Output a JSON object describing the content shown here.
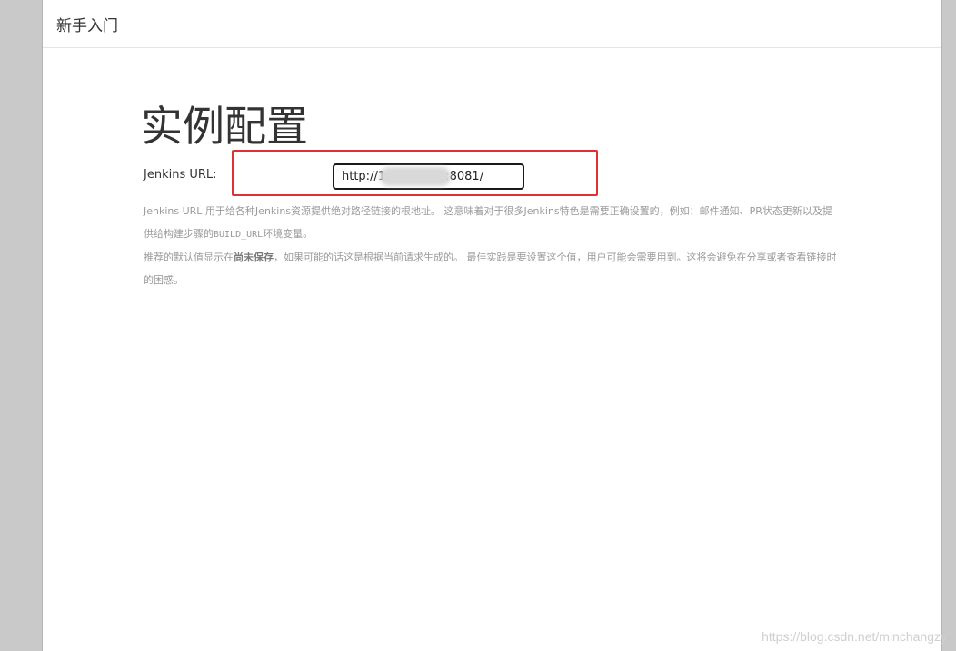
{
  "header": {
    "title": "新手入门"
  },
  "main": {
    "page_title": "实例配置",
    "jenkins_url_label": "Jenkins URL:",
    "jenkins_url_value": "http://1            31:8081/",
    "help": {
      "p1_text": "Jenkins URL 用于给各种Jenkins资源提供绝对路径链接的根地址。 这意味着对于很多Jenkins特色是需要正确设置的，例如：邮件通知、PR状态更新以及提供给构建步骤的",
      "p1_code": "BUILD_URL",
      "p1_suffix": "环境变量。",
      "p2_prefix": "推荐的默认值显示在",
      "p2_bold": "尚未保存",
      "p2_suffix": "，如果可能的话这是根据当前请求生成的。 最佳实践是要设置这个值，用户可能会需要用到。这将会避免在分享或者查看链接时的困惑。"
    }
  },
  "watermark": "https://blog.csdn.net/minchangzy",
  "colors": {
    "highlight": "#e03131",
    "input_border": "#1a1a1a",
    "help_text": "#9a9a9a",
    "backdrop": "#c9c9c9"
  }
}
